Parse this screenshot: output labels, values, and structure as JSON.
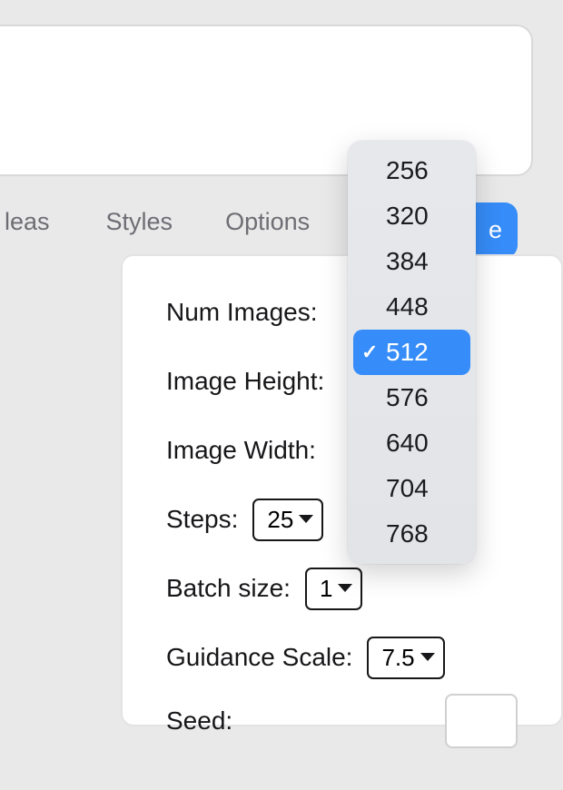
{
  "prompt": {
    "value": ""
  },
  "tabs": {
    "ideas": "leas",
    "styles": "Styles",
    "options": "Options"
  },
  "generate_button_fragment": "e",
  "options": {
    "num_images": {
      "label": "Num Images:"
    },
    "image_height": {
      "label": "Image Height:"
    },
    "image_width": {
      "label": "Image Width:"
    },
    "steps": {
      "label": "Steps:",
      "value": "25"
    },
    "batch_size": {
      "label": "Batch size:",
      "value": "1"
    },
    "guidance_scale": {
      "label": "Guidance Scale:",
      "value": "7.5"
    },
    "seed": {
      "label": "Seed:",
      "value": ""
    }
  },
  "dropdown": {
    "items": [
      "256",
      "320",
      "384",
      "448",
      "512",
      "576",
      "640",
      "704",
      "768"
    ],
    "selected_index": 4
  }
}
